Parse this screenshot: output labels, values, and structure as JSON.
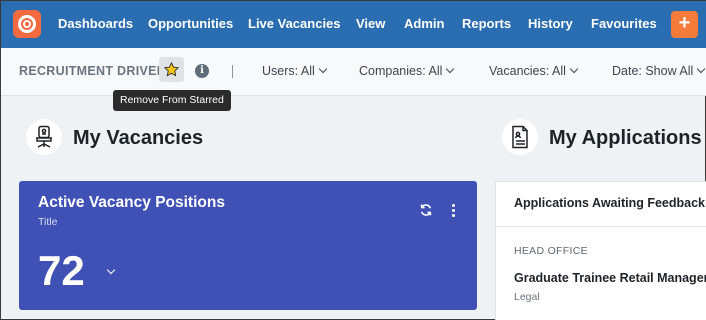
{
  "nav": {
    "items": [
      "Dashboards",
      "Opportunities",
      "Live Vacancies",
      "View",
      "Admin",
      "Reports",
      "History",
      "Favourites"
    ],
    "add_label": "+"
  },
  "filterbar": {
    "title": "RECRUITMENT DRIVER",
    "info": "i",
    "filters": [
      {
        "label": "Users: All"
      },
      {
        "label": "Companies: All"
      },
      {
        "label": "Vacancies: All"
      },
      {
        "label": "Date: Show All"
      }
    ]
  },
  "tooltip": "Remove From Starred",
  "sections": {
    "vacancies_title": "My Vacancies",
    "applications_title": "My Applications"
  },
  "vacancy_card": {
    "title": "Active Vacancy Positions",
    "subtitle": "Title",
    "value": "72"
  },
  "applications_card": {
    "header": "Applications Awaiting Feedback",
    "office": "HEAD OFFICE",
    "role": "Graduate Trainee Retail Manager",
    "category": "Legal"
  },
  "colors": {
    "nav_bg": "#2a6db0",
    "accent": "#f26a3d",
    "vacancy_card_bg": "#3f51b5",
    "star": "#f5c518"
  }
}
